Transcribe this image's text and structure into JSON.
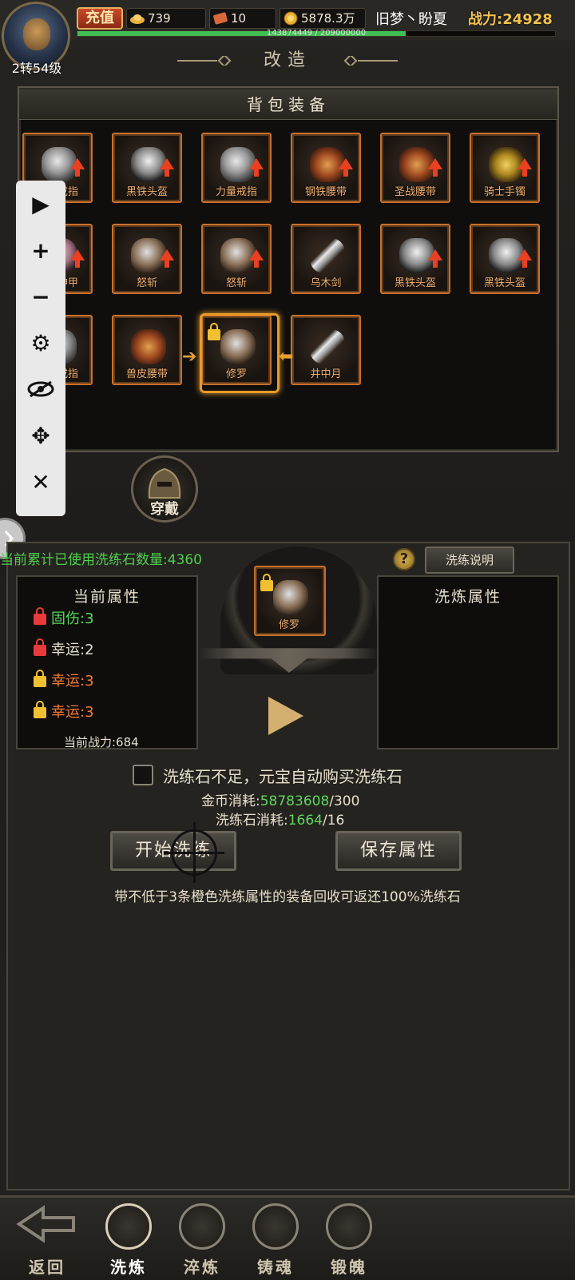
{
  "player": {
    "level_text": "2转54级",
    "name": "旧梦丶盼夏",
    "power_text": "战力:24928",
    "exp_text": "143874449 / 209000000",
    "exp_fraction": 0.688
  },
  "top": {
    "recharge_label": "充值",
    "ingot": "739",
    "coupon": "10",
    "gold": "5878.3万"
  },
  "title": "改造",
  "bag": {
    "title": "背包装备",
    "items": [
      {
        "name": "力量戒指",
        "icon": "ring-icon",
        "upgrade": true
      },
      {
        "name": "黑铁头盔",
        "icon": "helmet-icon",
        "upgrade": true
      },
      {
        "name": "力量戒指",
        "icon": "ring-icon",
        "upgrade": true
      },
      {
        "name": "钢铁腰带",
        "icon": "belt-icon",
        "upgrade": true
      },
      {
        "name": "圣战腰带",
        "icon": "belt-icon",
        "upgrade": true
      },
      {
        "name": "骑士手镯",
        "icon": "bracelet-icon",
        "upgrade": true
      },
      {
        "name": "天魔神甲",
        "icon": "armor-icon",
        "upgrade": true
      },
      {
        "name": "怒斩",
        "icon": "axe-icon",
        "upgrade": true
      },
      {
        "name": "怒斩",
        "icon": "axe-icon",
        "upgrade": true
      },
      {
        "name": "乌木剑",
        "icon": "sword-icon",
        "upgrade": false
      },
      {
        "name": "黑铁头盔",
        "icon": "helmet-icon",
        "upgrade": true
      },
      {
        "name": "黑铁头盔",
        "icon": "helmet-icon",
        "upgrade": true
      },
      {
        "name": "牛角戒指",
        "icon": "ring-icon",
        "upgrade": false
      },
      {
        "name": "兽皮腰带",
        "icon": "belt-icon",
        "upgrade": false
      },
      {
        "name": "修罗",
        "icon": "axe-icon",
        "upgrade": false,
        "locked": true,
        "selected": true
      },
      {
        "name": "井中月",
        "icon": "sword-icon",
        "upgrade": false
      }
    ]
  },
  "wear_label": "穿戴",
  "forge": {
    "used_stones_text": "当前累计已使用洗练石数量:",
    "used_stones_value": "4360",
    "help_label": "?",
    "explain_label": "洗练说明",
    "current_title": "当前属性",
    "refine_title": "洗炼属性",
    "current_attrs": [
      {
        "text": "固伤:3",
        "lock": "red",
        "color": "#5ad85a"
      },
      {
        "text": "幸运:2",
        "lock": "red",
        "color": "#e8e0cc"
      },
      {
        "text": "幸运:3",
        "lock": "yellow",
        "color": "#f07a3a"
      },
      {
        "text": "幸运:3",
        "lock": "yellow",
        "color": "#f07a3a"
      }
    ],
    "current_power": "当前战力:684",
    "item_name": "修罗",
    "auto_buy_label": "洗练石不足，元宝自动购买洗练石",
    "gold_cost_label": "金币消耗:",
    "gold_cost_have": "58783608",
    "gold_cost_need": "/300",
    "stone_cost_label": "洗练石消耗:",
    "stone_cost_have": "1664",
    "stone_cost_need": "/16",
    "start_label": "开始洗练",
    "save_label": "保存属性",
    "tip": "带不低于3条橙色洗练属性的装备回收可返还100%洗练石"
  },
  "nav": [
    {
      "label": "返回",
      "icon": "back-arrow-icon"
    },
    {
      "label": "洗炼",
      "icon": "refine-icon"
    },
    {
      "label": "淬炼",
      "icon": "temper-icon"
    },
    {
      "label": "铸魂",
      "icon": "soul-cast-icon"
    },
    {
      "label": "锻魄",
      "icon": "demon-forge-icon"
    }
  ],
  "toolbar": [
    "play-icon",
    "zoom-in-icon",
    "zoom-out-icon",
    "settings-icon",
    "hide-icon",
    "move-icon",
    "close-icon"
  ],
  "colors": {
    "accent": "#e89a2a",
    "power": "#f2c14e",
    "green": "#4cd04c",
    "lock_red": "#e83a3a",
    "lock_yellow": "#f0c030"
  }
}
